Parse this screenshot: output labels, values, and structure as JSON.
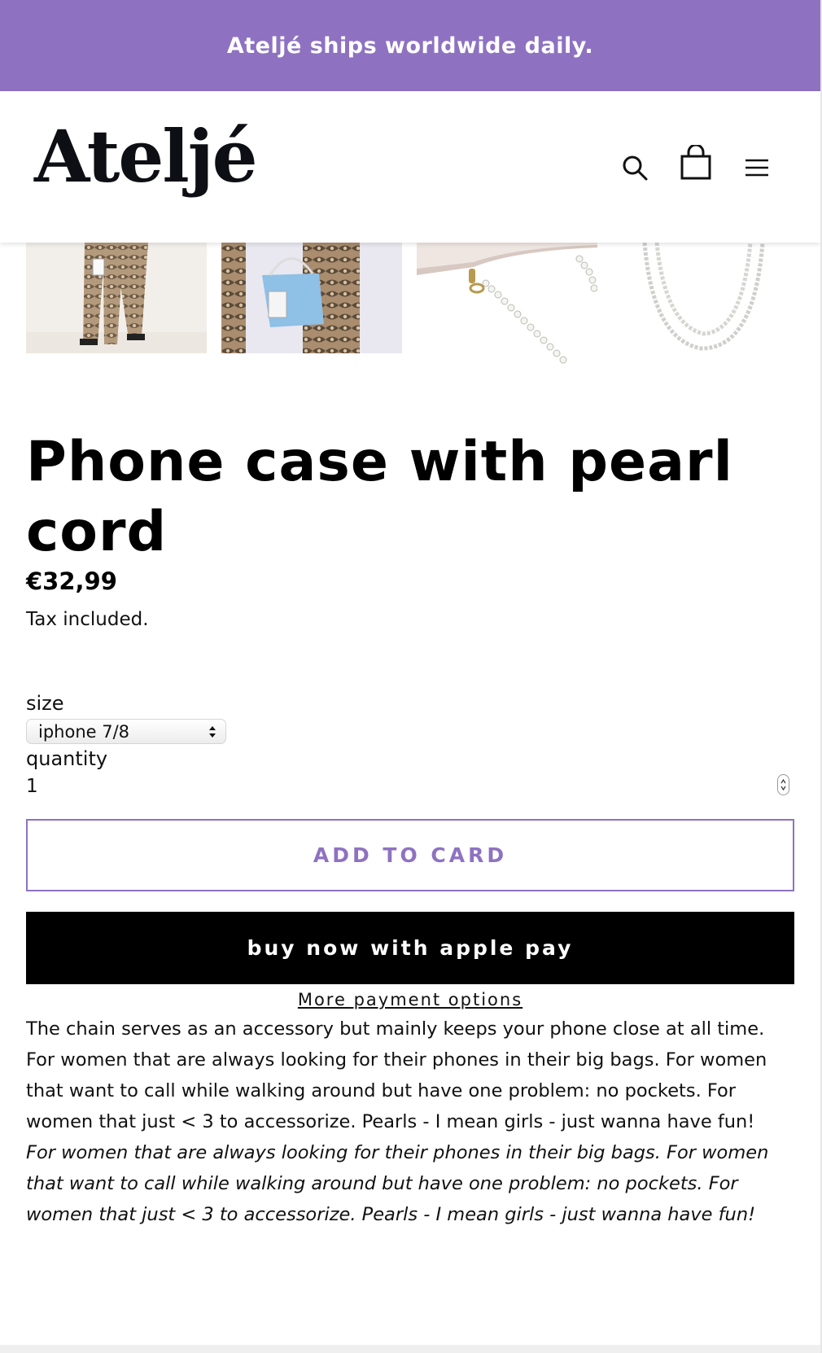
{
  "announcement": {
    "text": "Ateljé ships worldwide daily."
  },
  "header": {
    "logo_text": "Ateljé",
    "icons": [
      "search-icon",
      "shopping-bag-icon",
      "menu-icon"
    ]
  },
  "gallery": {
    "thumbnail_count": 4
  },
  "product": {
    "title": "Phone case with pearl cord",
    "price": "€32,99",
    "tax_note": "Tax included."
  },
  "options": {
    "size_label": "size",
    "size_selected": "iphone 7/8",
    "quantity_label": "quantity",
    "quantity_value": "1"
  },
  "actions": {
    "add_to_cart": "ADD TO CARD",
    "buy_now": "buy now with apple pay",
    "more_payment": "More payment options"
  },
  "description": {
    "p1": "The chain serves as an accessory but mainly keeps your phone close at all time.",
    "p2": "For women that are always looking for their phones in their big bags. For women that want to call while walking around but have one problem: no pockets. For women that just < 3 to accessorize. Pearls - I mean girls - just wanna have fun!",
    "p3": "For women that are always looking for their phones in their big bags. For women that want to call while walking around but have one problem: no pockets. For women that just < 3 to accessorize. Pearls - I mean girls - just wanna have fun!"
  },
  "colors": {
    "accent": "#8e72c1",
    "buy_button": "#000000",
    "text": "#111111"
  }
}
